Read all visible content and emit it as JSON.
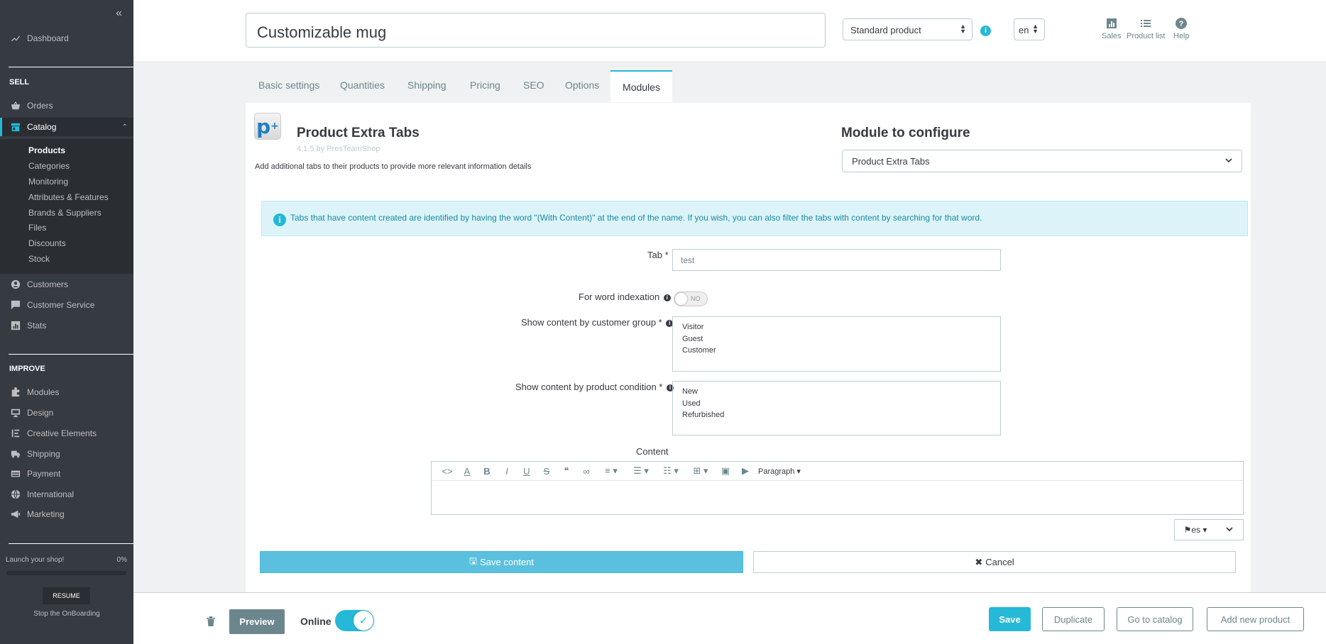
{
  "sidebar": {
    "collapse_icon": "«",
    "dashboard": "Dashboard",
    "sell_title": "SELL",
    "orders": "Orders",
    "catalog": "Catalog",
    "catalog_sub": [
      "Products",
      "Categories",
      "Monitoring",
      "Attributes & Features",
      "Brands & Suppliers",
      "Files",
      "Discounts",
      "Stock"
    ],
    "customers": "Customers",
    "customer_service": "Customer Service",
    "stats": "Stats",
    "improve_title": "IMPROVE",
    "modules": "Modules",
    "design": "Design",
    "creative_elements": "Creative Elements",
    "shipping": "Shipping",
    "payment": "Payment",
    "international": "International",
    "marketing": "Marketing",
    "onboarding_label": "Launch your shop!",
    "onboarding_pct": "0%",
    "resume": "RESUME",
    "stop_onboarding": "Stop the OnBoarding"
  },
  "header": {
    "product_name": "Customizable mug",
    "product_type": "Standard product",
    "info_icon": "i",
    "language": "en",
    "links": {
      "sales": "Sales",
      "product_list": "Product list",
      "help": "Help"
    }
  },
  "tabs": {
    "basic": "Basic settings",
    "quantities": "Quantities",
    "shipping": "Shipping",
    "pricing": "Pricing",
    "seo": "SEO",
    "options": "Options",
    "modules": "Modules"
  },
  "module": {
    "logo_text": "p",
    "logo_sup": "+",
    "title": "Product Extra Tabs",
    "version": "4.1.5 by PresTeamShop",
    "description": "Add additional tabs to their products to provide more relevant information details",
    "configure_title": "Module to configure",
    "configure_value": "Product Extra Tabs"
  },
  "alert": {
    "icon": "i",
    "text": "Tabs that have content created are identified by having the word \"(With Content)\" at the end of the name. If you wish, you can also filter the tabs with content by searching for that word."
  },
  "form": {
    "tab_label": "Tab *",
    "tab_value": "test",
    "word_index_label": "For word indexation",
    "toggle_no": "NO",
    "group_label": "Show content by customer group *",
    "groups": [
      "Visitor",
      "Guest",
      "Customer"
    ],
    "condition_label": "Show content by product condition *",
    "conditions": [
      "New",
      "Used",
      "Refurbished"
    ],
    "content_label": "Content",
    "paragraph": "Paragraph",
    "lang": "es",
    "save_content": "Save content",
    "cancel": "Cancel"
  },
  "footer": {
    "preview": "Preview",
    "online": "Online",
    "save": "Save",
    "duplicate": "Duplicate",
    "go_to_catalog": "Go to catalog",
    "add_new_product": "Add new product"
  },
  "colors": {
    "accent": "#25b9d7",
    "sidebar": "#363a41",
    "info": "#5bc0de"
  }
}
